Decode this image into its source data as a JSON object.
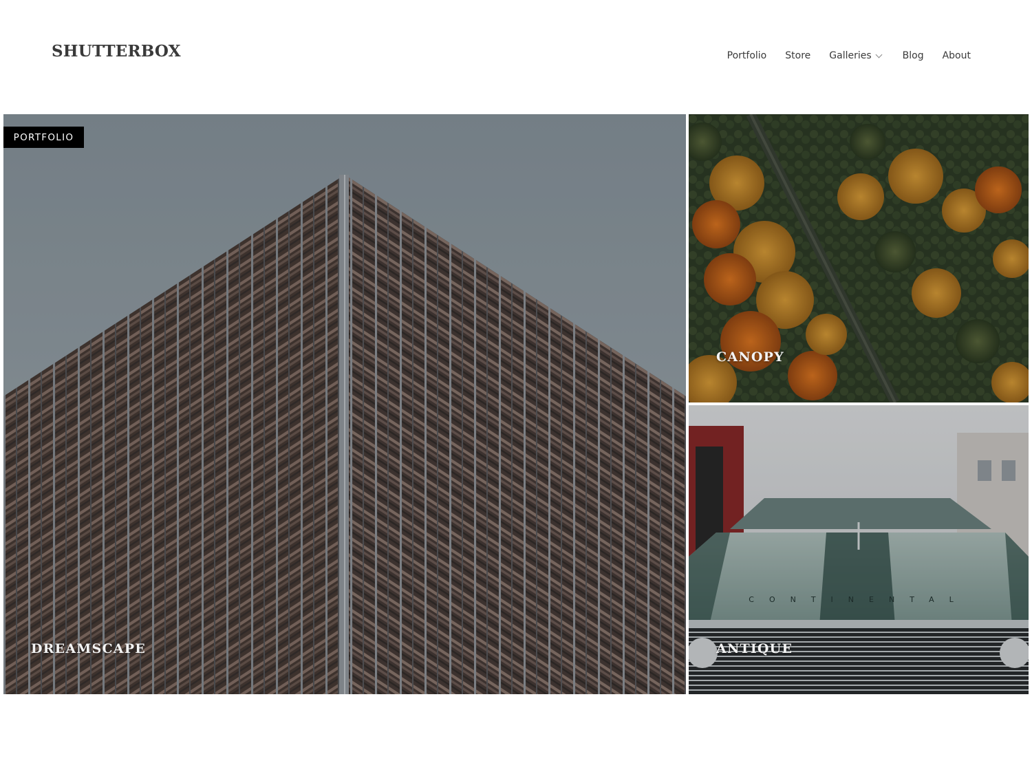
{
  "site": {
    "logo": "SHUTTERBOX"
  },
  "nav": {
    "items": [
      {
        "label": "Portfolio"
      },
      {
        "label": "Store"
      },
      {
        "label": "Galleries",
        "icon": "chevron-down-icon"
      },
      {
        "label": "Blog"
      },
      {
        "label": "About"
      }
    ]
  },
  "category_badge": "PORTFOLIO",
  "tiles": [
    {
      "title": "DREAMSCAPE",
      "image": "building-facade-photo"
    },
    {
      "title": "CANOPY",
      "image": "aerial-forest-photo"
    },
    {
      "title": "ANTIQUE",
      "image": "vintage-car-photo",
      "plate_text": "CONTINENTAL"
    }
  ],
  "colors": {
    "text": "#3a3a3a",
    "badge_bg": "#000000",
    "badge_text": "#ffffff",
    "tile_title": "#f4f4f4"
  }
}
